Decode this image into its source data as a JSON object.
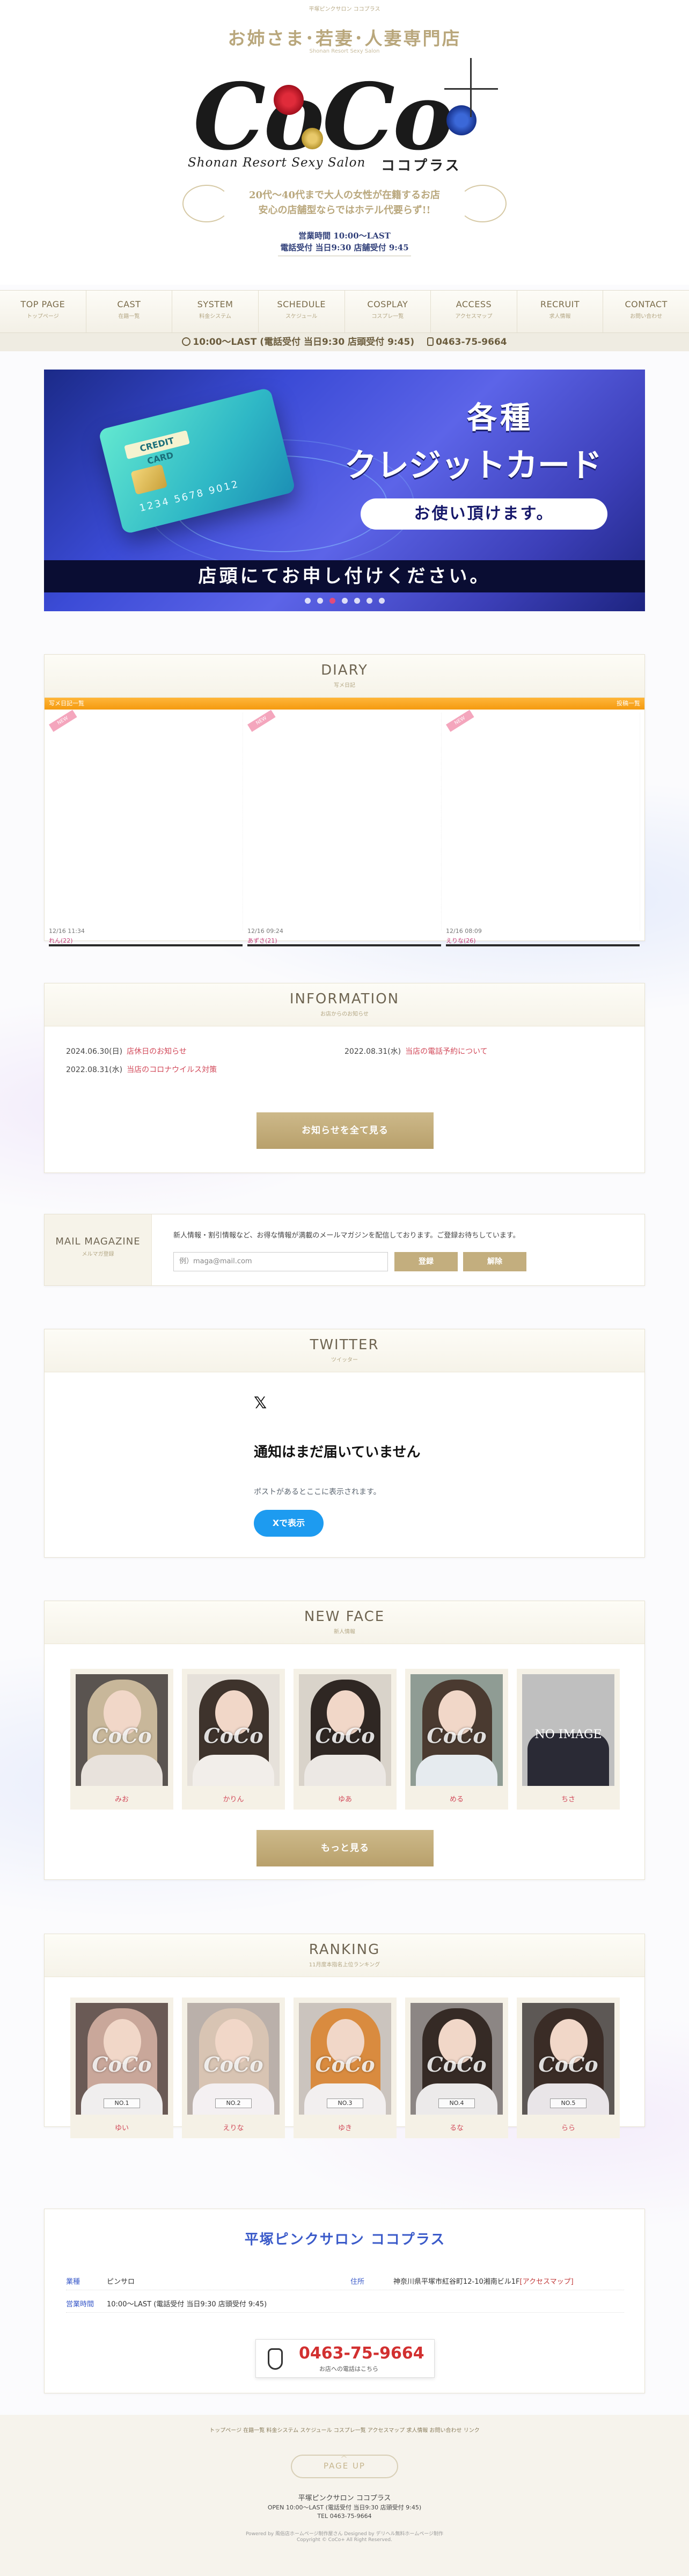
{
  "header": {
    "tagline_top": "平塚ピンクサロン ココプラス",
    "catchcopy": "お姉さま･若妻･人妻専門店",
    "catchcopy_sub": "Shonan Resort Sexy Salon",
    "logo_main": "CoCo",
    "logo_sub": "Shonan Resort Sexy Salon",
    "logo_kana": "ココプラス",
    "message_lines": [
      "20代～40代まで大人の女性が在籍するお店",
      "安心の店舗型ならではホテル代要らず!!"
    ],
    "hours_line1": "営業時間 10:00～LAST",
    "hours_line2": "電話受付 当日9:30 店舗受付 9:45"
  },
  "nav": [
    {
      "en": "TOP PAGE",
      "jp": "トップページ"
    },
    {
      "en": "CAST",
      "jp": "在籍一覧"
    },
    {
      "en": "SYSTEM",
      "jp": "料金システム"
    },
    {
      "en": "SCHEDULE",
      "jp": "スケジュール"
    },
    {
      "en": "COSPLAY",
      "jp": "コスプレ一覧"
    },
    {
      "en": "ACCESS",
      "jp": "アクセスマップ"
    },
    {
      "en": "RECRUIT",
      "jp": "求人情報"
    },
    {
      "en": "CONTACT",
      "jp": "お問い合わせ"
    }
  ],
  "infobar": {
    "hours": "10:00～LAST (電話受付 当日9:30 店頭受付 9:45)",
    "phone": "0463-75-9664"
  },
  "banner": {
    "card_label": "CREDIT CARD",
    "card_number": "1234 5678 9012",
    "line1": "各種",
    "line2": "クレジットカード",
    "pill": "お使い頂けます。",
    "bar": "店頭にてお申し付けください。",
    "dots": 7,
    "active_dot": 3
  },
  "diary": {
    "title_en": "DIARY",
    "title_jp": "写メ日記",
    "bar_left": "写メ日記一覧",
    "bar_right": "投稿一覧",
    "entries": [
      {
        "tag": "NEW",
        "date": "12/16 11:34",
        "name": "れん(22)"
      },
      {
        "tag": "NEW",
        "date": "12/16 09:24",
        "name": "あずさ(21)"
      },
      {
        "tag": "NEW",
        "date": "12/16 08:09",
        "name": "えりな(26)"
      }
    ]
  },
  "information": {
    "title_en": "INFORMATION",
    "title_jp": "お店からのお知らせ",
    "items": [
      {
        "date": "2024.06.30(日)",
        "text": "店休日のお知らせ"
      },
      {
        "date": "2022.08.31(水)",
        "text": "当店の電話予約について"
      },
      {
        "date": "2022.08.31(水)",
        "text": "当店のコロナウイルス対策"
      }
    ],
    "button": "お知らせを全て見る"
  },
  "mail": {
    "title_en": "MAIL MAGAZINE",
    "title_jp": "メルマガ登録",
    "text": "新人情報・割引情報など、お得な情報が満載のメールマガジンを配信しております。ご登録お待ちしています。",
    "placeholder": "例）maga@mail.com",
    "register": "登録",
    "unregister": "解除"
  },
  "twitter": {
    "title_en": "TWITTER",
    "title_jp": "ツイッター",
    "logo": "𝕏",
    "heading": "通知はまだ届いていません",
    "sub": "ポストがあるとここに表示されます。",
    "button": "Xで表示"
  },
  "newface": {
    "title_en": "NEW FACE",
    "title_jp": "新人情報",
    "watermark": "CoCo",
    "noimage": "NO IMAGE",
    "girls": [
      {
        "name": "みお",
        "hair": "#c8b79a",
        "cloth": "#e8e2dc",
        "bg": "#5a5450"
      },
      {
        "name": "かりん",
        "hair": "#3e332c",
        "cloth": "#f2eeea",
        "bg": "#e6e1da"
      },
      {
        "name": "ゆあ",
        "hair": "#2f2723",
        "cloth": "#ece8e4",
        "bg": "#d9d3ca"
      },
      {
        "name": "める",
        "hair": "#4a3a30",
        "cloth": "#e6ebef",
        "bg": "#8f9c94"
      },
      {
        "name": "ちさ",
        "hair": "#b5b5b5",
        "cloth": "#2a2a35",
        "bg": "#bfbfbf"
      }
    ],
    "button": "もっと見る"
  },
  "ranking": {
    "title_en": "RANKING",
    "title_jp": "11月度本指名上位ランキング",
    "watermark": "CoCo",
    "girls": [
      {
        "no": "NO.1",
        "name": "ゆい",
        "hair": "#c9a79a",
        "cloth": "#f0eeee",
        "bg": "#6a5a55"
      },
      {
        "no": "NO.2",
        "name": "えりな",
        "hair": "#d8c4b3",
        "cloth": "#f4f0f2",
        "bg": "#bab0aa"
      },
      {
        "no": "NO.3",
        "name": "ゆき",
        "hair": "#d98b3f",
        "cloth": "#f2efef",
        "bg": "#cbc4be"
      },
      {
        "no": "NO.4",
        "name": "るな",
        "hair": "#352a25",
        "cloth": "#eceaea",
        "bg": "#8c8684"
      },
      {
        "no": "NO.5",
        "name": "らら",
        "hair": "#3a2c26",
        "cloth": "#e9e5e8",
        "bg": "#5d5855"
      }
    ]
  },
  "shop": {
    "title": "平塚ピンクサロン ココプラス",
    "genre_label": "業種",
    "genre": "ピンサロ",
    "hours_label": "営業時間",
    "hours": "10:00～LAST (電話受付 当日9:30 店頭受付 9:45)",
    "address_label": "住所",
    "address": "神奈川県平塚市紅谷町12-10湘南ビル1F",
    "access_link": "[アクセスマップ]",
    "tel": "0463-75-9664",
    "tel_sub": "お店への電話はこちら"
  },
  "footer": {
    "links": "トップページ 在籍一覧 料金システム スケジュール コスプレ一覧 アクセスマップ 求人情報 お問い合わせ リンク",
    "pageup_arrow": "︿",
    "pageup": "PAGE UP",
    "name": "平塚ピンクサロン ココプラス",
    "open": "OPEN 10:00～LAST (電話受付 当日9:30 店頭受付 9:45)",
    "tel": "TEL 0463-75-9664",
    "powered": "Powered by 風俗店ホームページ制作屋さん Designed by デリヘル無料ホームページ制作",
    "copyright": "Copyright © CoCo+ All Right Reserved."
  }
}
